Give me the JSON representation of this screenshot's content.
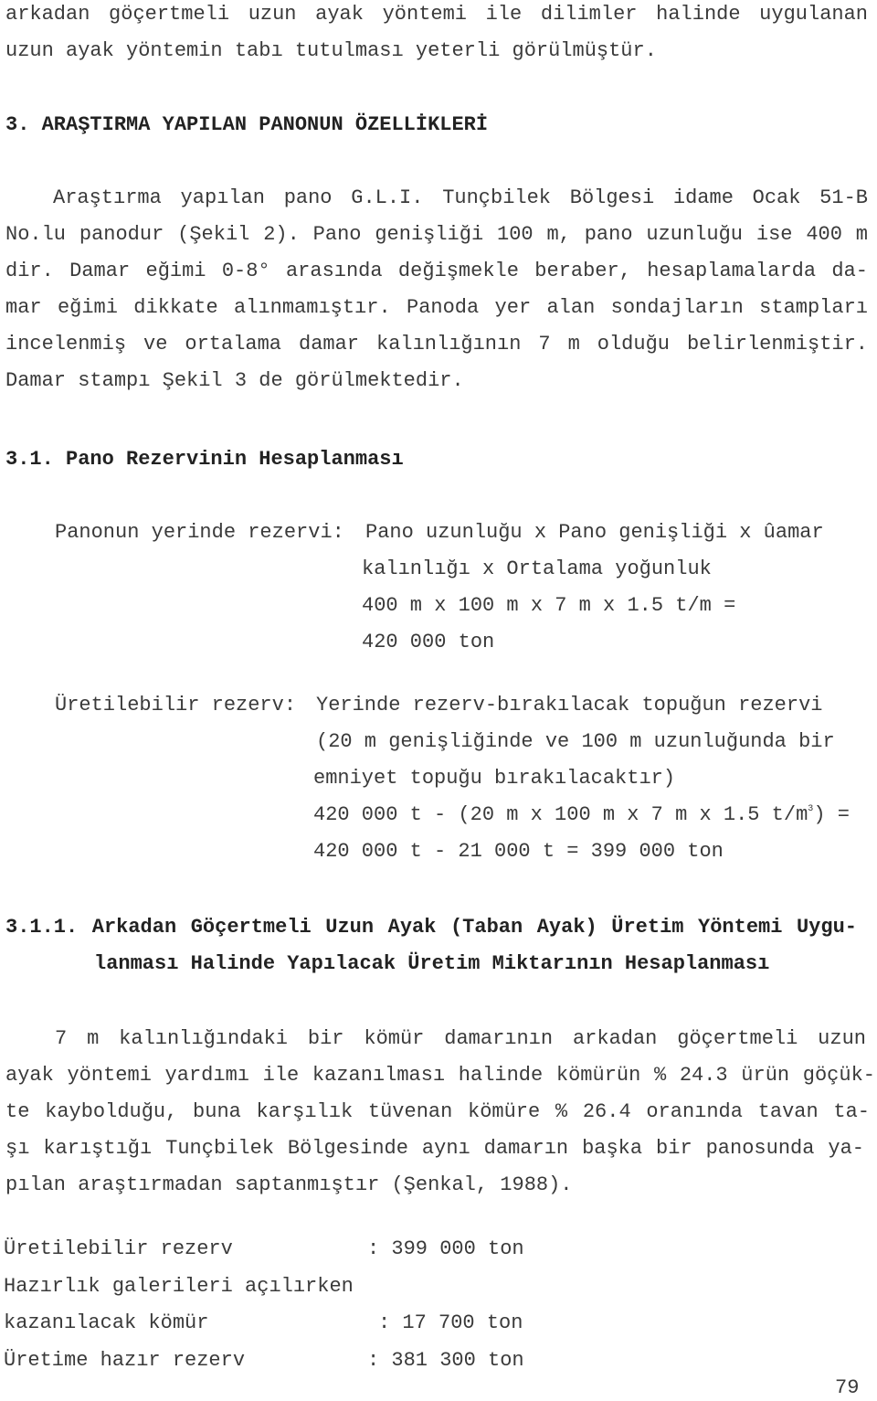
{
  "intro_lines": [
    "arkadan göçertmeli uzun ayak yöntemi ile dilimler halinde uygulanan",
    "uzun ayak yöntemin tabı tutulması yeterli görülmüştür."
  ],
  "section3": {
    "heading": "3. ARAŞTIRMA YAPILAN PANONUN ÖZELLİKLERİ",
    "lines": [
      "Araştırma yapılan pano G.L.I. Tunçbilek Bölgesi idame Ocak 51-B",
      "No.lu panodur (Şekil 2). Pano genişliği 100 m, pano uzunluğu ise 400 m",
      "dir. Damar eğimi 0-8° arasında değişmekle beraber, hesaplamalarda da-",
      "mar eğimi dikkate alınmamıştır. Panoda yer alan sondajların stampları",
      "incelenmiş ve ortalama damar kalınlığının 7 m olduğu belirlenmiştir.",
      "Damar stampı Şekil 3 de görülmektedir."
    ]
  },
  "section31": {
    "heading": "3.1. Pano Rezervinin Hesaplanması",
    "in_place": {
      "label": "Panonun yerinde rezervi:",
      "lines": [
        "Pano uzunluğu x Pano genişliği x ûamar",
        "kalınlığı x Ortalama yoğunluk",
        "400 m x 100 m x 7 m x 1.5 t/m =",
        "420 000 ton"
      ]
    },
    "producible": {
      "label": "Üretilebilir rezerv:",
      "lines": [
        "Yerinde rezerv-bırakılacak topuğun rezervi",
        "(20 m genişliğinde ve 100 m uzunluğunda bir",
        "emniyet topuğu bırakılacaktır)"
      ],
      "calc_pre": "420 000 t - (20 m x 100 m x 7 m x 1.5 t/m",
      "calc_sup": "3",
      "calc_post": ") =",
      "result": "420 000 t - 21 000 t = 399 000 ton"
    }
  },
  "section311": {
    "heading_lines": [
      "3.1.1. Arkadan Göçertmeli Uzun Ayak (Taban Ayak) Üretim Yöntemi Uygu-",
      "lanması Halinde Yapılacak Üretim Miktarının Hesaplanması"
    ],
    "lines": [
      "7 m kalınlığındaki bir kömür damarının arkadan göçertmeli uzun",
      "ayak yöntemi yardımı ile kazanılması halinde kömürün % 24.3 ürün göçük-",
      "te kaybolduğu, buna karşılık tüvenan kömüre % 26.4 oranında tavan ta-",
      "şı karıştığı Tunçbilek Bölgesinde aynı damarın başka bir panosunda ya-",
      "pılan araştırmadan saptanmıştır (Şenkal, 1988)."
    ]
  },
  "summary": [
    {
      "label": "Üretilebilir rezerv",
      "value": ": 399 000 ton"
    },
    {
      "label": "Hazırlık galerileri açılırken",
      "value": ""
    },
    {
      "label": "kazanılacak kömür",
      "value": ": 17 700 ton"
    },
    {
      "label": "Üretime hazır rezerv",
      "value": ": 381 300 ton"
    }
  ],
  "page_number": "79"
}
